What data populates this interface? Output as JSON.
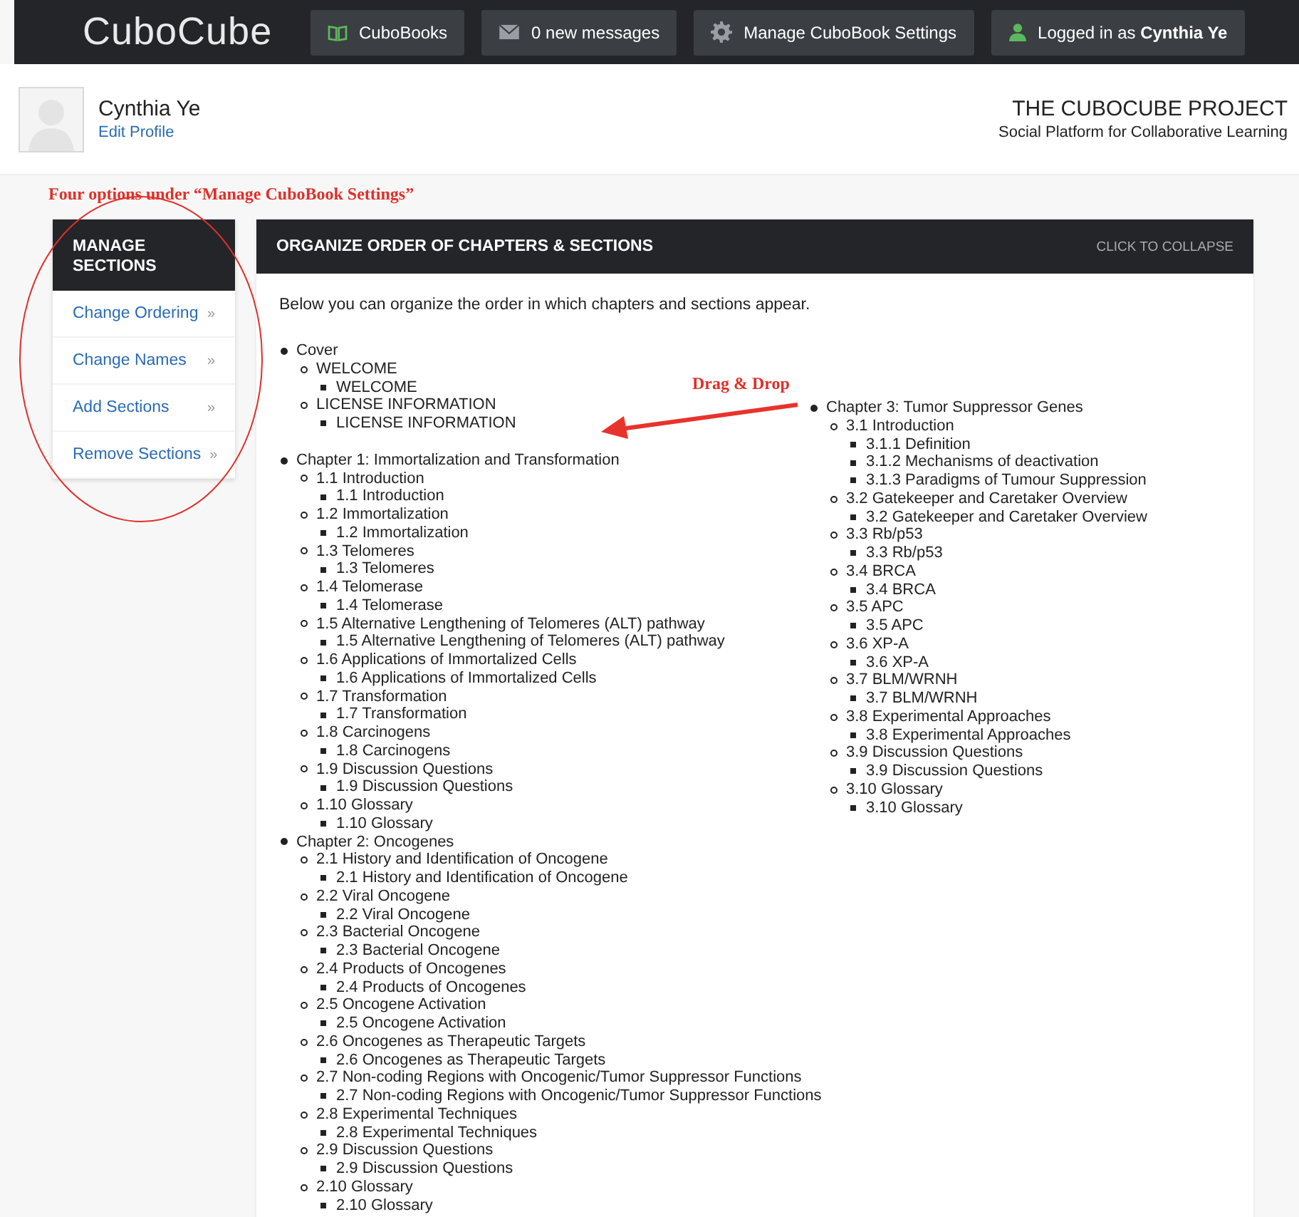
{
  "nav": {
    "logo": "CuboCube",
    "items": [
      {
        "kind": "book",
        "label": "CuboBooks"
      },
      {
        "kind": "mail",
        "label": "0 new messages"
      },
      {
        "kind": "gear",
        "label": "Manage CuboBook Settings"
      },
      {
        "kind": "user",
        "label": "Logged in as **Cynthia Ye**"
      }
    ]
  },
  "profile": {
    "name": "Cynthia Ye",
    "link": "Edit Profile"
  },
  "project": {
    "title": "THE CUBOCUBE PROJECT",
    "subtitle": "Social Platform for Collaborative Learning"
  },
  "sidebar": {
    "title": "MANAGE SECTIONS",
    "items": [
      {
        "label": "Change Ordering",
        "chevron": "»"
      },
      {
        "label": "Change Names",
        "chevron": "»"
      },
      {
        "label": "Add Sections",
        "chevron": "»"
      },
      {
        "label": "Remove Sections",
        "chevron": "»"
      }
    ]
  },
  "panel": {
    "title": "ORGANIZE ORDER OF CHAPTERS & SECTIONS",
    "action": "CLICK TO COLLAPSE",
    "intro": "Below you can organize the order in which chapters and sections appear.",
    "columns": [
      {
        "items": [
          {
            "label": "Cover",
            "children": [
              {
                "label": "WELCOME",
                "children": [
                  {
                    "label": "WELCOME"
                  }
                ]
              },
              {
                "label": "LICENSE INFORMATION",
                "children": [
                  {
                    "label": "LICENSE INFORMATION"
                  }
                ]
              }
            ]
          },
          {
            "label": "Chapter 1: Immortalization and Transformation",
            "children": [
              {
                "label": "1.1 Introduction",
                "children": [
                  {
                    "label": "1.1 Introduction"
                  }
                ]
              },
              {
                "label": "1.2 Immortalization",
                "children": [
                  {
                    "label": "1.2 Immortalization"
                  }
                ]
              },
              {
                "label": "1.3 Telomeres",
                "children": [
                  {
                    "label": "1.3 Telomeres"
                  }
                ]
              },
              {
                "label": "1.4 Telomerase",
                "children": [
                  {
                    "label": "1.4 Telomerase"
                  }
                ]
              },
              {
                "label": "1.5 Alternative Lengthening of Telomeres (ALT) pathway",
                "children": [
                  {
                    "label": "1.5 Alternative Lengthening of Telomeres (ALT) pathway"
                  }
                ]
              },
              {
                "label": "1.6 Applications of Immortalized Cells",
                "children": [
                  {
                    "label": "1.6 Applications of Immortalized Cells"
                  }
                ]
              },
              {
                "label": "1.7 Transformation",
                "children": [
                  {
                    "label": "1.7 Transformation"
                  }
                ]
              },
              {
                "label": "1.8 Carcinogens",
                "children": [
                  {
                    "label": "1.8 Carcinogens"
                  }
                ]
              },
              {
                "label": "1.9 Discussion Questions",
                "children": [
                  {
                    "label": "1.9 Discussion Questions"
                  }
                ]
              },
              {
                "label": "1.10 Glossary",
                "children": [
                  {
                    "label": "1.10 Glossary"
                  }
                ]
              }
            ]
          },
          {
            "label": "Chapter 2: Oncogenes",
            "children": [
              {
                "label": "2.1 History and Identification of Oncogene",
                "children": [
                  {
                    "label": "2.1 History and Identification of Oncogene"
                  }
                ]
              },
              {
                "label": "2.2 Viral Oncogene",
                "children": [
                  {
                    "label": "2.2 Viral Oncogene"
                  }
                ]
              },
              {
                "label": "2.3 Bacterial Oncogene",
                "children": [
                  {
                    "label": "2.3 Bacterial Oncogene"
                  }
                ]
              },
              {
                "label": "2.4 Products of Oncogenes",
                "children": [
                  {
                    "label": "2.4 Products of Oncogenes"
                  }
                ]
              },
              {
                "label": "2.5 Oncogene Activation",
                "children": [
                  {
                    "label": "2.5 Oncogene Activation"
                  }
                ]
              },
              {
                "label": "2.6 Oncogenes as Therapeutic Targets",
                "children": [
                  {
                    "label": "2.6 Oncogenes as Therapeutic Targets"
                  }
                ]
              },
              {
                "label": "2.7 Non-coding Regions with Oncogenic/Tumor Suppressor Functions",
                "children": [
                  {
                    "label": "2.7 Non-coding Regions with Oncogenic/Tumor Suppressor Functions"
                  }
                ]
              },
              {
                "label": "2.8 Experimental Techniques",
                "children": [
                  {
                    "label": "2.8 Experimental Techniques"
                  }
                ]
              },
              {
                "label": "2.9 Discussion Questions",
                "children": [
                  {
                    "label": "2.9 Discussion Questions"
                  }
                ]
              },
              {
                "label": "2.10 Glossary",
                "children": [
                  {
                    "label": "2.10 Glossary"
                  }
                ]
              }
            ]
          }
        ]
      },
      {
        "items": [
          {
            "label": "Chapter 3: Tumor Suppressor Genes",
            "children": [
              {
                "label": "3.1 Introduction",
                "children": [
                  {
                    "label": "3.1.1 Definition"
                  },
                  {
                    "label": "3.1.2 Mechanisms of deactivation"
                  },
                  {
                    "label": "3.1.3 Paradigms of Tumour Suppression"
                  }
                ]
              },
              {
                "label": "3.2 Gatekeeper and Caretaker Overview",
                "children": [
                  {
                    "label": "3.2 Gatekeeper and Caretaker Overview"
                  }
                ]
              },
              {
                "label": "3.3 Rb/p53",
                "children": [
                  {
                    "label": "3.3 Rb/p53"
                  }
                ]
              },
              {
                "label": "3.4 BRCA",
                "children": [
                  {
                    "label": "3.4 BRCA"
                  }
                ]
              },
              {
                "label": "3.5 APC",
                "children": [
                  {
                    "label": "3.5 APC"
                  }
                ]
              },
              {
                "label": "3.6 XP-A",
                "children": [
                  {
                    "label": "3.6 XP-A"
                  }
                ]
              },
              {
                "label": "3.7 BLM/WRNH",
                "children": [
                  {
                    "label": "3.7 BLM/WRNH"
                  }
                ]
              },
              {
                "label": "3.8 Experimental Approaches",
                "children": [
                  {
                    "label": "3.8 Experimental Approaches"
                  }
                ]
              },
              {
                "label": "3.9 Discussion Questions",
                "children": [
                  {
                    "label": "3.9 Discussion Questions"
                  }
                ]
              },
              {
                "label": "3.10 Glossary",
                "children": [
                  {
                    "label": "3.10 Glossary"
                  }
                ]
              }
            ]
          }
        ]
      }
    ]
  },
  "annotations": {
    "options_note": "Four options under “Manage CuboBook Settings”",
    "drag_note": "Drag & Drop"
  }
}
